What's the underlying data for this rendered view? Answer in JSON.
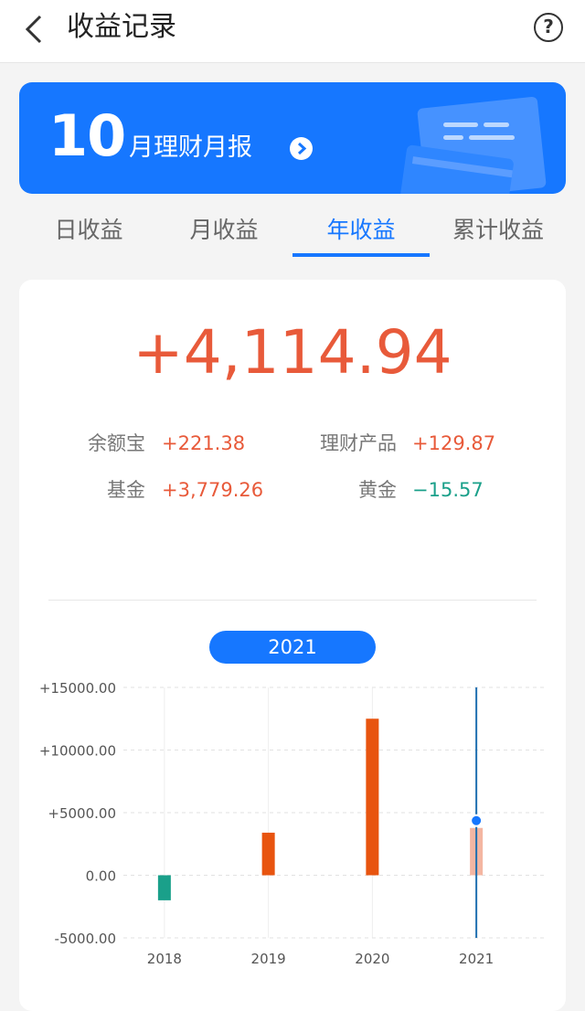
{
  "header": {
    "title": "收益记录",
    "back_icon": "chevron-left-icon",
    "help_icon": "question-circle-icon",
    "help_glyph": "?"
  },
  "banner": {
    "month": "10",
    "text": "月理财月报",
    "arrow_icon": "chevron-right-circle-icon"
  },
  "tabs": [
    {
      "label": "日收益",
      "active": false
    },
    {
      "label": "月收益",
      "active": false
    },
    {
      "label": "年收益",
      "active": true
    },
    {
      "label": "累计收益",
      "active": false
    }
  ],
  "summary": {
    "total": "+4,114.94",
    "items": [
      {
        "label": "余额宝",
        "value": "+221.38",
        "sign": "pos"
      },
      {
        "label": "理财产品",
        "value": "+129.87",
        "sign": "pos"
      },
      {
        "label": "基金",
        "value": "+3,779.26",
        "sign": "pos"
      },
      {
        "label": "黄金",
        "value": "−15.57",
        "sign": "neg"
      }
    ]
  },
  "selected_year": "2021",
  "colors": {
    "accent": "#1677ff",
    "positive": "#e85a3a",
    "negative": "#1aa08a",
    "bar_positive": "#e8540f",
    "bar_selected": "#f4b6a2"
  },
  "chart_data": {
    "type": "bar",
    "categories": [
      "2018",
      "2019",
      "2020",
      "2021"
    ],
    "values": [
      -2000,
      3400,
      12500,
      3779
    ],
    "selected_index": 3,
    "y_ticks": [
      "+15000.00",
      "+10000.00",
      "+5000.00",
      "0.00",
      "-5000.00"
    ],
    "ylim": [
      -5000,
      15000
    ],
    "grid": true
  }
}
